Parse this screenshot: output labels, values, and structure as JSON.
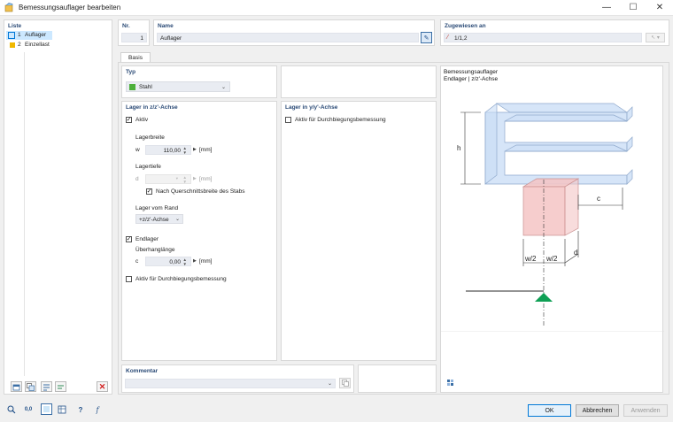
{
  "window": {
    "title": "Bemessungsauflager bearbeiten",
    "minimize": "—",
    "maximize": "☐",
    "close": "✕"
  },
  "list": {
    "header": "Liste",
    "items": [
      {
        "number": "1",
        "name": "Auflager",
        "color": "#00a8e0",
        "selected": true
      },
      {
        "number": "2",
        "name": "Einzellast",
        "color": "#f0b800",
        "selected": false
      }
    ]
  },
  "header": {
    "nr_label": "Nr.",
    "nr_value": "1",
    "name_label": "Name",
    "name_value": "Auflager",
    "assigned_label": "Zugewiesen an",
    "assigned_value": "1/1,2"
  },
  "tabs": [
    {
      "label": "Basis",
      "active": true
    }
  ],
  "type_section": {
    "header": "Typ",
    "value": "Stahl",
    "color": "#4caf3a"
  },
  "zz_section": {
    "header": "Lager in z/z'-Achse",
    "active_label": "Aktiv",
    "active_checked": true,
    "width_label": "Lagerbreite",
    "width_symbol": "w",
    "width_value": "110,00",
    "width_unit": "[mm]",
    "depth_label": "Lagertiefe",
    "depth_symbol": "d",
    "depth_value": "",
    "depth_unit": "[mm]",
    "cross_label": "Nach Querschnittsbreite des Stabs",
    "cross_checked": true,
    "edge_label": "Lager vom Rand",
    "edge_value": "+z/z'-Achse",
    "end_label": "Endlager",
    "end_checked": true,
    "overhang_label": "Überhanglänge",
    "overhang_symbol": "c",
    "overhang_value": "0,00",
    "overhang_unit": "[mm]",
    "deflection_label": "Aktiv für Durchbiegungsbemessung",
    "deflection_checked": false
  },
  "yy_section": {
    "header": "Lager in y/y'-Achse",
    "deflection_label": "Aktiv für Durchbiegungsbemessung",
    "deflection_checked": false
  },
  "preview": {
    "title": "Bemessungsauflager",
    "subtitle": "Endlager | z/z'-Achse",
    "dim_h": "h",
    "dim_c": "c",
    "dim_w1": "w/2",
    "dim_w2": "w/2",
    "dim_d": "d"
  },
  "comment": {
    "header": "Kommentar",
    "value": ""
  },
  "buttons": {
    "ok": "OK",
    "cancel": "Abbrechen",
    "apply": "Anwenden"
  }
}
